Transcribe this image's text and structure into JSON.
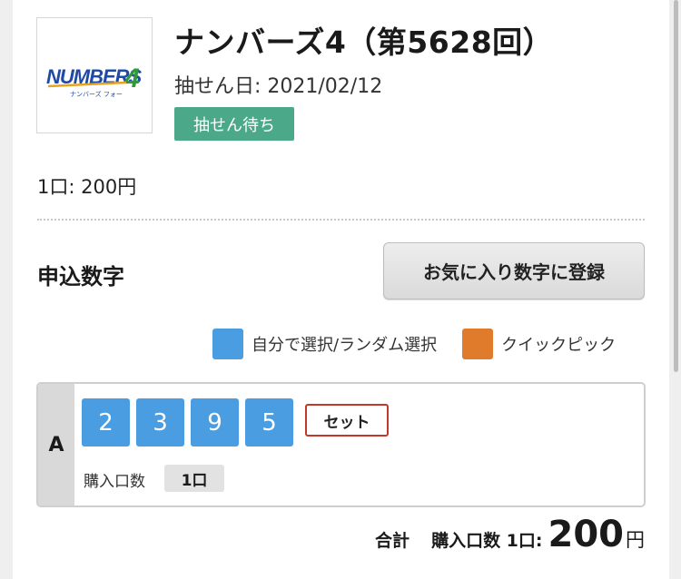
{
  "lottery": {
    "logo_text": "NUMBERS4",
    "logo_subtext": "ナンバーズ フォー",
    "title": "ナンバーズ4（第5628回）",
    "draw_date": "抽せん日: 2021/02/12",
    "status": "抽せん待ち",
    "unit_price": "1口: 200円"
  },
  "selection": {
    "section_title": "申込数字",
    "favorite_button": "お気に入り数字に登録",
    "legend": [
      {
        "label": "自分で選択/ランダム選択",
        "color": "#4a9de0"
      },
      {
        "label": "クイックピック",
        "color": "#e07b2c"
      }
    ]
  },
  "entry": {
    "label": "A",
    "digits": [
      "2",
      "3",
      "9",
      "5"
    ],
    "type_badge": "セット",
    "quantity_label": "購入口数",
    "quantity_value": "1口"
  },
  "total": {
    "label": "合計",
    "quantity": "購入口数 1口:",
    "amount": "200",
    "currency": "円"
  }
}
